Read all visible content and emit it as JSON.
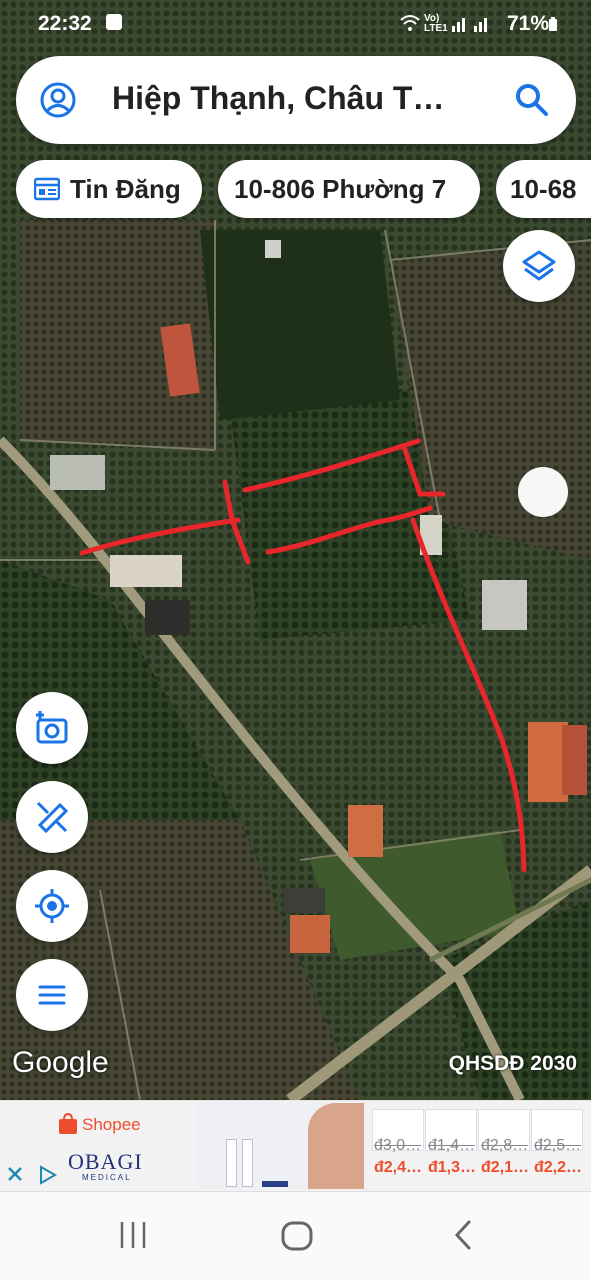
{
  "status": {
    "time": "22:32",
    "network": "Vo) LTE1",
    "battery": "71%"
  },
  "search": {
    "query": "Hiệp Thạnh, Châu T…"
  },
  "chips": [
    {
      "label": "Tin Đăng"
    },
    {
      "label": "10-806 Phường 7"
    },
    {
      "label": "10-68"
    }
  ],
  "map": {
    "attribution": "Google",
    "overlay_label": "QHSDĐ 2030"
  },
  "ad": {
    "shop_label": "Shopee",
    "brand": "OBAGI",
    "brand_sub": "MEDICAL",
    "products": [
      {
        "old_price": "đ3,0…",
        "price": "đ2,4…"
      },
      {
        "old_price": "đ1,4…",
        "price": "đ1,3…"
      },
      {
        "old_price": "đ2,8…",
        "price": "đ2,1…"
      },
      {
        "old_price": "đ2,5…",
        "price": "đ2,2…"
      }
    ]
  },
  "colors": {
    "accent": "#1a73e8",
    "annotation": "#e8262b",
    "shopee": "#ee4d2d"
  },
  "icons": [
    "account-icon",
    "search-icon",
    "listing-icon",
    "layers-icon",
    "camera-add-icon",
    "measure-icon",
    "my-location-icon",
    "menu-icon",
    "close-icon",
    "play-icon"
  ]
}
